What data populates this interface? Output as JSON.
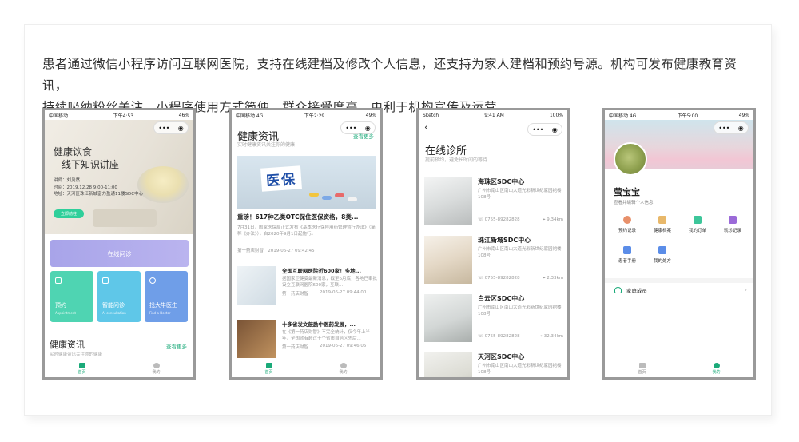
{
  "intro": {
    "line1": "患者通过微信小程序访问互联网医院，支持在线建档及修改个人信息，还支持为家人建档和预约号源。机构可发布健康教育资讯，",
    "line2": "持续吸纳粉丝关注。小程序使用方式简便，群众接受度高，更利于机构宣传及运营。"
  },
  "phone1": {
    "status": {
      "left": "中国移动",
      "time": "下午4:53",
      "right": "46%"
    },
    "banner": {
      "title1": "健康饮食",
      "title2": "线下知识讲座",
      "speaker": "讲师：刘见然",
      "time": "时间：2019.12.28  9:00-11:00",
      "address": "地址：天河区珠江新城富力盈通11楼SDC中心",
      "button": "立即前往"
    },
    "online_label": "在线问诊",
    "features": [
      {
        "label": "预约",
        "en": "Appointment"
      },
      {
        "label": "智能问诊",
        "en": "AI consultation"
      },
      {
        "label": "找大牛医生",
        "en": "Find a Doctor"
      }
    ],
    "news_title": "健康资讯",
    "news_sub": "实时健康资讯关注你的健康",
    "more": "查看更多",
    "tabs": [
      "首页",
      "我的"
    ]
  },
  "phone2": {
    "status": {
      "left": "中国移动  4G",
      "time": "下午2:29",
      "right": "49%"
    },
    "title": "健康资讯",
    "sub": "实时健康资讯关注你的健康",
    "more": "查看更多",
    "hero_word": "医保",
    "article1": {
      "title": "重磅！617种乙类OTC保住医保资格，8类...",
      "text": "7月31日，国家医保局正式发布《基本医疗保险用药管理暂行办法》（简称《办法》），自2020年9月1日起施行。",
      "source": "第一药店财智",
      "date": "2019-06-27 09:42:45"
    },
    "article2": {
      "title": "全国互联网医院近600家！多地...",
      "text": "据国家卫健委最新消息，截至6月底，各地已审批设立互联网医院600家，互联...",
      "source": "第一药店财智",
      "date": "2019-06-27 09:44:00"
    },
    "article3": {
      "title": "十多省发文鼓励中医药发展，...",
      "text": "在《第一药店财智》不完全统计，仅今年上半年，全国就有超过十个省市自治区先后...",
      "source": "第一药店财智",
      "date": "2019-06-27 09:46:05"
    },
    "tabs": [
      "首页",
      "我的"
    ]
  },
  "phone3": {
    "status": {
      "left": "Sketch",
      "time": "9:41 AM",
      "right": "100%"
    },
    "back": "‹",
    "title": "在线诊所",
    "sub": "提前预约，避免长时间的等待",
    "clinics": [
      {
        "name": "海珠区SDC中心",
        "address": "广州市南山区南山大道光彩新世纪家园裙楼108号",
        "tel": "0755-89282828",
        "dist": "9.34km"
      },
      {
        "name": "珠江新城SDC中心",
        "address": "广州市南山区南山大道光彩新世纪家园裙楼108号",
        "tel": "0755-89282828",
        "dist": "2.33km"
      },
      {
        "name": "白云区SDC中心",
        "address": "广州市南山区南山大道光彩新世纪家园裙楼108号",
        "tel": "0755-89282828",
        "dist": "32.34km"
      },
      {
        "name": "天河区SDC中心",
        "address": "广州市南山区南山大道光彩新世纪家园裙楼108号",
        "tel": "",
        "dist": ""
      }
    ]
  },
  "phone4": {
    "status": {
      "left": "中国移动  4G",
      "time": "下午5:00",
      "right": "49%"
    },
    "name": "萤宝宝",
    "sub": "查看并编辑个人信息",
    "grid": [
      {
        "label": "预约记录",
        "color": "#e8906a"
      },
      {
        "label": "健康档案",
        "color": "#e8b86a"
      },
      {
        "label": "我的订单",
        "color": "#3dc69a"
      },
      {
        "label": "就诊记录",
        "color": "#9b6ad8"
      },
      {
        "label": "患者手册",
        "color": "#5b8de8"
      },
      {
        "label": "我的处方",
        "color": "#5b8de8"
      }
    ],
    "family": "家庭成员",
    "tabs": [
      "首页",
      "我的"
    ]
  },
  "colors": {
    "accent": "#1aaa79",
    "online": "#a8a4e9",
    "feature1": "#4fd4b2",
    "feature2": "#5fc7e8",
    "feature3": "#6f9ee8"
  }
}
